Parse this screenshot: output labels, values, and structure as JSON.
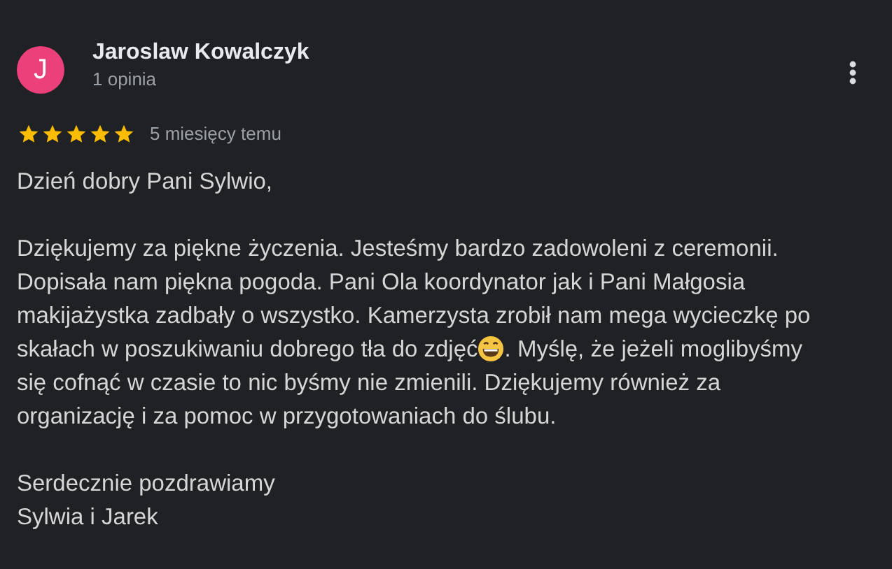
{
  "review": {
    "avatar_letter": "J",
    "author": "Jaroslaw Kowalczyk",
    "author_meta": "1 opinia",
    "stars": 5,
    "date": "5 miesięcy temu",
    "paragraphs": [
      [
        [
          {
            "kind": "text",
            "text": "Dzień dobry Pani Sylwio,"
          }
        ]
      ],
      [
        [
          {
            "kind": "text",
            "text": "Dziękujemy za piękne życzenia. Jesteśmy bardzo zadowoleni z ceremonii."
          }
        ],
        [
          {
            "kind": "text",
            "text": "Dopisała nam piękna pogoda. Pani Ola koordynator jak i Pani Małgosia"
          }
        ],
        [
          {
            "kind": "text",
            "text": "makijażystka zadbały o wszystko. Kamerzysta zrobił nam mega wycieczkę po"
          }
        ],
        [
          {
            "kind": "text",
            "text": "skałach w poszukiwaniu dobrego tła do zdjęć"
          },
          {
            "kind": "emoji"
          },
          {
            "kind": "text",
            "text": ". Myślę, że jeżeli moglibyśmy"
          }
        ],
        [
          {
            "kind": "text",
            "text": "się cofnąć w czasie to nic byśmy nie zmienili. Dziękujemy również za"
          }
        ],
        [
          {
            "kind": "text",
            "text": "organizację i za pomoc w przygotowaniach do ślubu."
          }
        ]
      ],
      [
        [
          {
            "kind": "text",
            "text": "Serdecznie pozdrawiamy"
          }
        ],
        [
          {
            "kind": "text",
            "text": "Sylwia i Jarek"
          }
        ]
      ]
    ]
  }
}
